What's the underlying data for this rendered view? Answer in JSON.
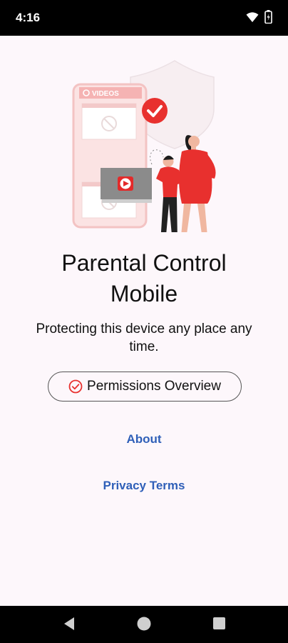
{
  "status_bar": {
    "time": "4:16"
  },
  "illustration": {
    "videos_label": "VIDEOS"
  },
  "main": {
    "title_line1": "Parental Control",
    "title_line2": "Mobile",
    "tagline": "Protecting this device any place any time.",
    "permissions_button": "Permissions Overview",
    "about_link": "About",
    "privacy_link": "Privacy Terms"
  },
  "colors": {
    "accent": "#e8302e",
    "link": "#2f5fb8",
    "background": "#fdf7fb"
  }
}
